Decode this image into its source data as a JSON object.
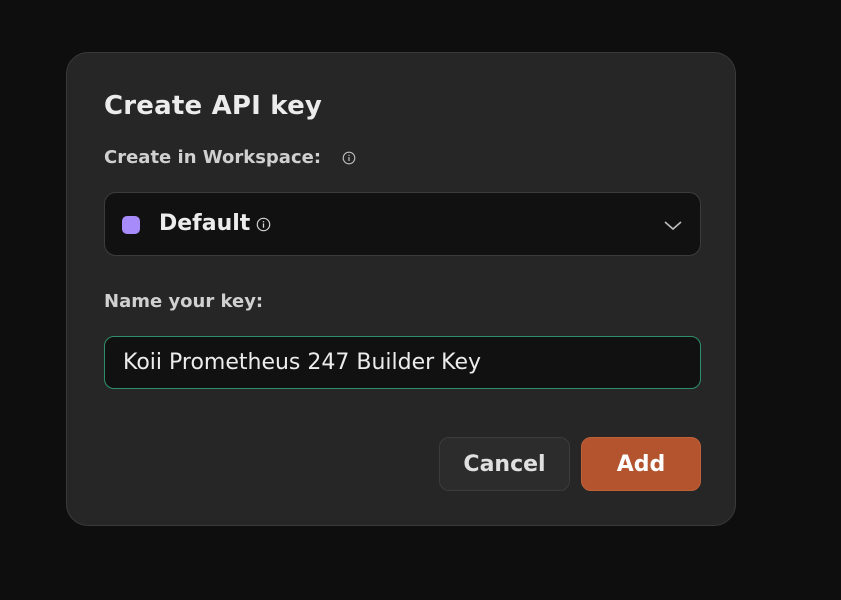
{
  "dialog": {
    "title": "Create API key",
    "workspace_label": "Create in Workspace:",
    "workspace_select": {
      "value": "Default",
      "swatch_color": "#a78bfa"
    },
    "name_label": "Name your key:",
    "name_input": {
      "value": "Koii Prometheus 247 Builder Key"
    },
    "buttons": {
      "cancel": "Cancel",
      "add": "Add"
    },
    "colors": {
      "accent": "#b4542f",
      "focus_border": "#2f8f6a"
    },
    "icons": {
      "workspace_info": "info-icon",
      "select_info": "info-icon",
      "select_chevron": "chevron-down-icon"
    }
  }
}
